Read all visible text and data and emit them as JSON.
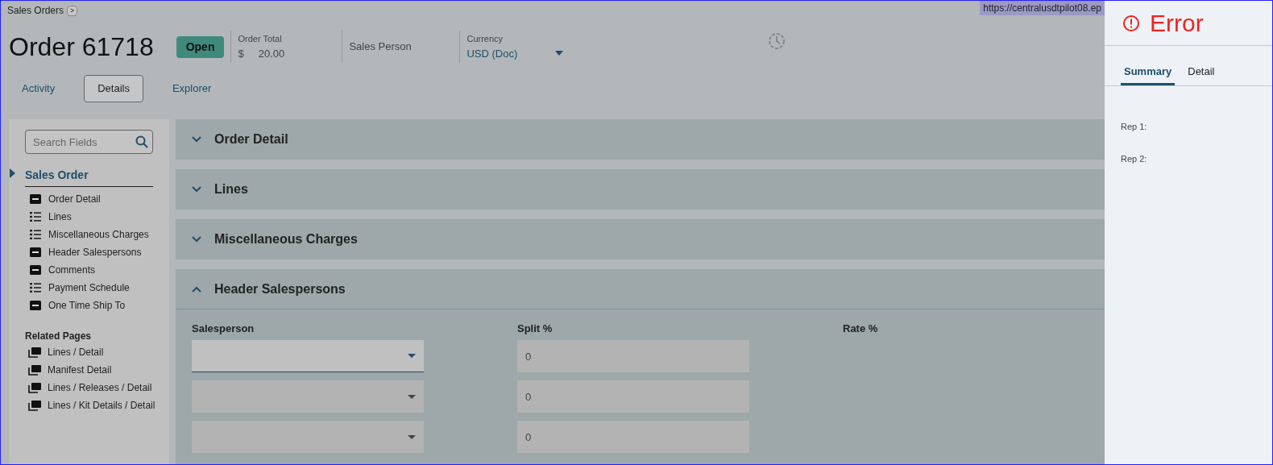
{
  "breadcrumb": {
    "label": "Sales Orders",
    "expand_glyph": ">"
  },
  "header": {
    "title": "Order 61718",
    "status": "Open",
    "order_total": {
      "label": "Order Total",
      "currency_symbol": "$",
      "value": "20.00"
    },
    "sales_person": {
      "label": "Sales Person"
    },
    "currency": {
      "label": "Currency",
      "value": "USD (Doc)"
    }
  },
  "url_tooltip": "https://centralusdtpilot08.ep",
  "tabs": [
    {
      "label": "Activity",
      "selected": false
    },
    {
      "label": "Details",
      "selected": true
    },
    {
      "label": "Explorer",
      "selected": false
    }
  ],
  "sidebar": {
    "search": {
      "placeholder": "Search Fields"
    },
    "group": {
      "label": "Sales Order",
      "selected": true
    },
    "items": [
      {
        "label": "Order Detail",
        "kind": "form"
      },
      {
        "label": "Lines",
        "kind": "list"
      },
      {
        "label": "Miscellaneous Charges",
        "kind": "list"
      },
      {
        "label": "Header Salespersons",
        "kind": "form"
      },
      {
        "label": "Comments",
        "kind": "form"
      },
      {
        "label": "Payment Schedule",
        "kind": "list"
      },
      {
        "label": "One Time Ship To",
        "kind": "form"
      }
    ],
    "related_title": "Related Pages",
    "related": [
      "Lines / Detail",
      "Manifest Detail",
      "Lines / Releases / Detail",
      "Lines / Kit Details / Detail"
    ]
  },
  "sections": [
    {
      "title": "Order Detail",
      "expanded": false
    },
    {
      "title": "Lines",
      "expanded": false
    },
    {
      "title": "Miscellaneous Charges",
      "expanded": false
    },
    {
      "title": "Header Salespersons",
      "expanded": true
    }
  ],
  "salespersons": {
    "columns": [
      "Salesperson",
      "Split %",
      "Rate %"
    ],
    "rows": [
      {
        "split": "0",
        "focused": true
      },
      {
        "split": "0",
        "focused": false
      },
      {
        "split": "0",
        "focused": false
      }
    ]
  },
  "error_panel": {
    "title": "Error",
    "tabs": [
      {
        "label": "Summary",
        "selected": true
      },
      {
        "label": "Detail",
        "selected": false
      }
    ],
    "lines": [
      "Rep 1:",
      "Rep 2:"
    ]
  }
}
